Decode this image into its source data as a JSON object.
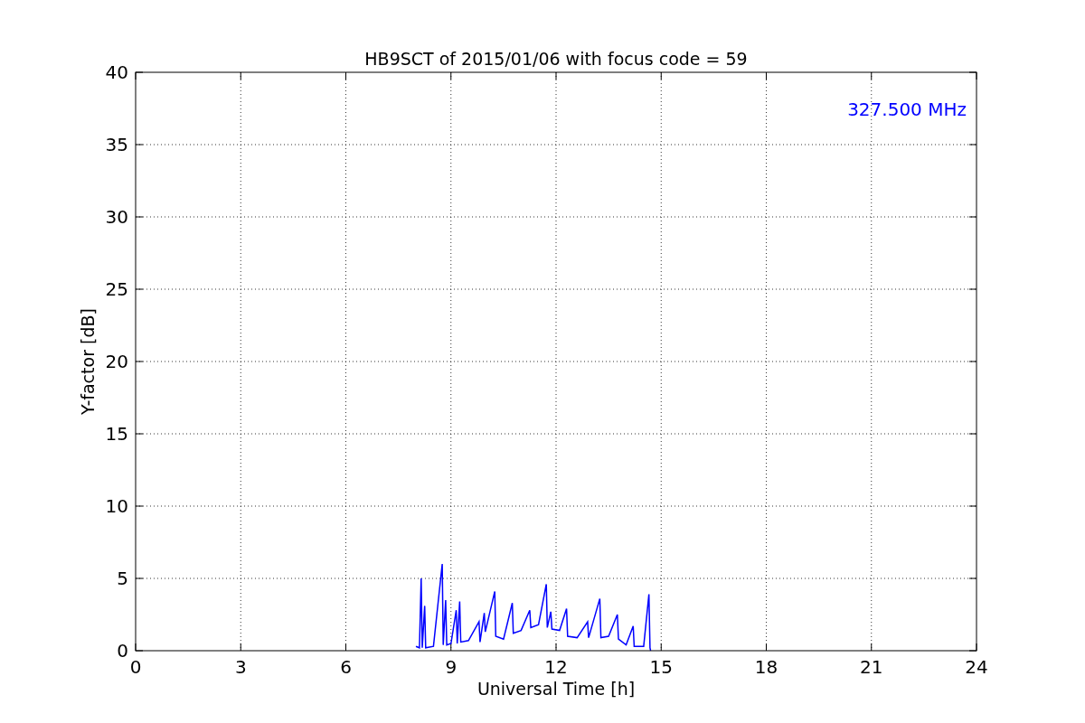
{
  "chart_data": {
    "type": "line",
    "title": "HB9SCT of 2015/01/06 with focus code = 59",
    "xlabel": "Universal Time [h]",
    "ylabel": "Y-factor [dB]",
    "x": [
      8.0,
      8.1,
      8.15,
      8.18,
      8.25,
      8.28,
      8.5,
      8.75,
      8.78,
      8.85,
      8.88,
      9.0,
      9.15,
      9.18,
      9.25,
      9.28,
      9.5,
      9.8,
      9.83,
      9.95,
      9.98,
      10.25,
      10.28,
      10.5,
      10.75,
      10.78,
      11.0,
      11.25,
      11.28,
      11.5,
      11.72,
      11.75,
      11.85,
      11.88,
      12.1,
      12.3,
      12.33,
      12.6,
      12.9,
      12.93,
      13.25,
      13.28,
      13.5,
      13.75,
      13.78,
      14.0,
      14.2,
      14.23,
      14.5,
      14.65,
      14.68,
      14.7
    ],
    "series": [
      {
        "name": "327.500 MHz",
        "color": "#0000ff",
        "values": [
          0.3,
          0.2,
          5.0,
          0.2,
          3.1,
          0.2,
          0.3,
          6.0,
          0.4,
          3.5,
          0.4,
          0.5,
          2.8,
          0.5,
          3.4,
          0.6,
          0.7,
          2.0,
          0.6,
          2.6,
          1.3,
          4.1,
          1.0,
          0.8,
          3.3,
          1.2,
          1.4,
          2.8,
          1.6,
          1.8,
          4.6,
          1.6,
          2.7,
          1.5,
          1.4,
          2.9,
          1.0,
          0.9,
          2.0,
          0.9,
          3.6,
          0.9,
          1.0,
          2.5,
          0.8,
          0.4,
          1.7,
          0.3,
          0.3,
          3.9,
          0.2,
          0.0
        ]
      }
    ],
    "xlim": [
      0,
      24
    ],
    "ylim": [
      0,
      40
    ],
    "xticks": [
      0,
      3,
      6,
      9,
      12,
      15,
      18,
      21,
      24
    ],
    "yticks": [
      0,
      5,
      10,
      15,
      20,
      25,
      30,
      35,
      40
    ],
    "grid": true
  }
}
